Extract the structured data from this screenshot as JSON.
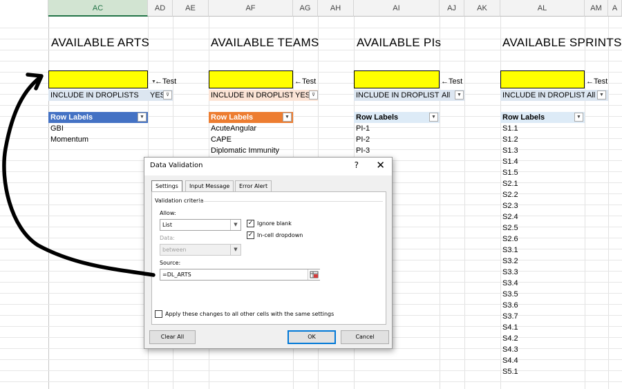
{
  "columns": [
    {
      "id": "AC",
      "selected": true
    },
    {
      "id": "AD"
    },
    {
      "id": "AE"
    },
    {
      "id": "AF"
    },
    {
      "id": "AG"
    },
    {
      "id": "AH"
    },
    {
      "id": "AI"
    },
    {
      "id": "AJ"
    },
    {
      "id": "AK"
    },
    {
      "id": "AL"
    },
    {
      "id": "AM"
    },
    {
      "id": "A"
    }
  ],
  "sections": {
    "arts": {
      "title": "AVAILABLE ARTS",
      "test": "←Test",
      "include_label": "INCLUDE IN DROPLISTS",
      "include_value": "YES",
      "row_labels": "Row Labels",
      "items": [
        "GBI",
        "Momentum"
      ]
    },
    "teams": {
      "title": "AVAILABLE TEAMS",
      "test": "←Test",
      "include_label": "INCLUDE IN DROPLISTS",
      "include_value": "YES",
      "row_labels": "Row Labels",
      "items": [
        "AcuteAngular",
        "CAPE",
        "Diplomatic Immunity"
      ]
    },
    "pis": {
      "title": "AVAILABLE PIs",
      "test": "←Test",
      "include_label": "INCLUDE IN DROPLISTS",
      "include_value": "All",
      "row_labels": "Row Labels",
      "items": [
        "PI-1",
        "PI-2",
        "PI-3"
      ]
    },
    "sprints": {
      "title": "AVAILABLE SPRINTS",
      "test": "←Test",
      "include_label": "INCLUDE IN DROPLISTS",
      "include_value": "All",
      "row_labels": "Row Labels",
      "items": [
        "S1.1",
        "S1.2",
        "S1.3",
        "S1.4",
        "S1.5",
        "S2.1",
        "S2.2",
        "S2.3",
        "S2.4",
        "S2.5",
        "S2.6",
        "S3.1",
        "S3.2",
        "S3.3",
        "S3.4",
        "S3.5",
        "S3.6",
        "S3.7",
        "S4.1",
        "S4.2",
        "S4.3",
        "S4.4",
        "S5.1"
      ]
    }
  },
  "dialog": {
    "title": "Data Validation",
    "help": "?",
    "close": "✕",
    "tabs": [
      "Settings",
      "Input Message",
      "Error Alert"
    ],
    "group_label": "Validation criteria",
    "allow_label": "Allow:",
    "allow_value": "List",
    "ignore_blank": "Ignore blank",
    "incell_dropdown": "In-cell dropdown",
    "data_label": "Data:",
    "data_value": "between",
    "source_label": "Source:",
    "source_value": "=DL_ARTS",
    "apply_all": "Apply these changes to all other cells with the same settings",
    "clear_all": "Clear All",
    "ok": "OK",
    "cancel": "Cancel"
  },
  "colors": {
    "highlight": "#ffff00",
    "pivot_blue": "#4472c4",
    "pivot_orange": "#ed7d31",
    "pivot_light": "#ddebf7",
    "ok_border": "#0078d7"
  }
}
